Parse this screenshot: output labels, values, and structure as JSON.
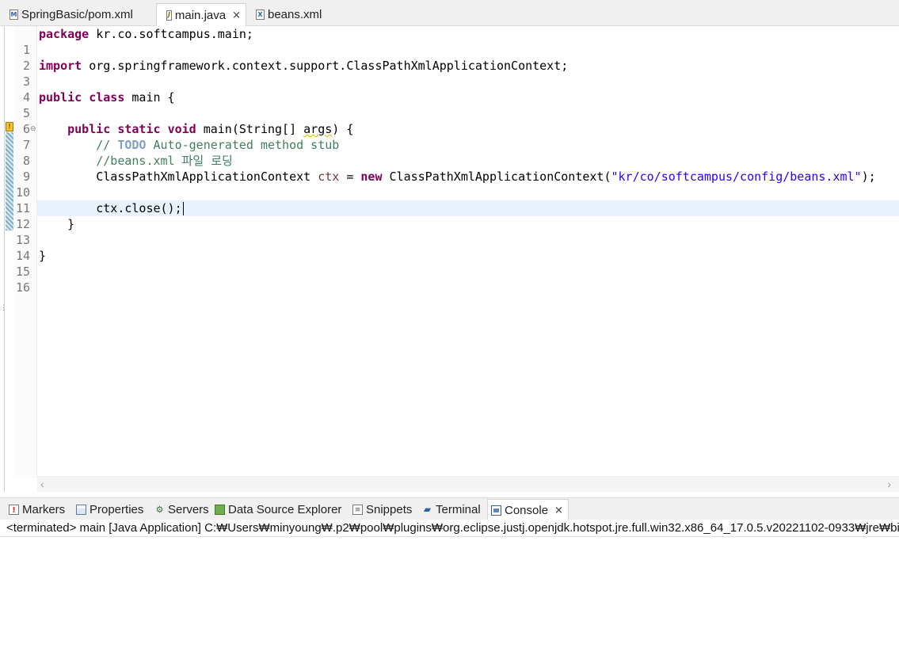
{
  "editor_tabs": [
    {
      "label": "SpringBasic/pom.xml",
      "icon": "maven-pom-file-icon",
      "icon_glyph": "M"
    },
    {
      "label": "main.java",
      "icon": "java-file-icon",
      "icon_glyph": "J",
      "close": "×",
      "active": true
    },
    {
      "label": "beans.xml",
      "icon": "xml-file-icon",
      "icon_glyph": "X"
    }
  ],
  "code": {
    "line_numbers": [
      "1",
      "2",
      "3",
      "4",
      "5",
      "6",
      "7",
      "8",
      "9",
      "10",
      "11",
      "12",
      "13",
      "14",
      "15",
      "16"
    ],
    "l1": {
      "kw": "package",
      "rest": " kr.co.softcampus.main;"
    },
    "l3": {
      "kw": "import",
      "rest": " org.springframework.context.support.ClassPathXmlApplicationContext;"
    },
    "l5": {
      "kw1": "public",
      "kw2": "class",
      "rest": " main {"
    },
    "l7": {
      "indent": "    ",
      "kw1": "public",
      "kw2": "static",
      "kw3": "void",
      "mid": " main(String[] ",
      "param": "args",
      "end": ") {"
    },
    "l8": {
      "indent": "        ",
      "prefix": "// ",
      "todo": "TODO",
      "rest": " Auto-generated method stub"
    },
    "l9": {
      "indent": "        ",
      "comment": "//beans.xml 파일 로딩"
    },
    "l10": {
      "indent": "        ",
      "type": "ClassPathXmlApplicationContext ",
      "var": "ctx",
      "eq": " = ",
      "kw": "new",
      "call": " ClassPathXmlApplicationContext(",
      "str": "\"kr/co/softcampus/config/beans.xml\"",
      "end": ");"
    },
    "l12": {
      "indent": "        ",
      "text": "ctx.close();"
    },
    "l13": {
      "text": "    }"
    },
    "l15": {
      "text": "}"
    },
    "current_line": "12"
  },
  "views_tabs": [
    {
      "label": "Markers",
      "icon": "markers-icon"
    },
    {
      "label": "Properties",
      "icon": "properties-icon"
    },
    {
      "label": "Servers",
      "icon": "servers-icon"
    },
    {
      "label": "Data Source Explorer",
      "icon": "data-source-explorer-icon"
    },
    {
      "label": "Snippets",
      "icon": "snippets-icon"
    },
    {
      "label": "Terminal",
      "icon": "terminal-icon"
    },
    {
      "label": "Console",
      "icon": "console-icon",
      "active": true,
      "close": "×"
    }
  ],
  "console": {
    "header": "<terminated> main [Java Application] C:₩Users₩minyoung₩.p2₩pool₩plugins₩org.eclipse.justj.openjdk.hotspot.jre.full.win32.x86_64_17.0.5.v20221102-0933₩jre₩bin₩javaw.exe"
  },
  "colors": {
    "keyword": "#7f0055",
    "comment": "#3f7f5f",
    "todo": "#7f9fbf",
    "string": "#2a00ff",
    "local_variable": "#6a3e3e",
    "current_line_highlight": "#e8f2fe"
  }
}
